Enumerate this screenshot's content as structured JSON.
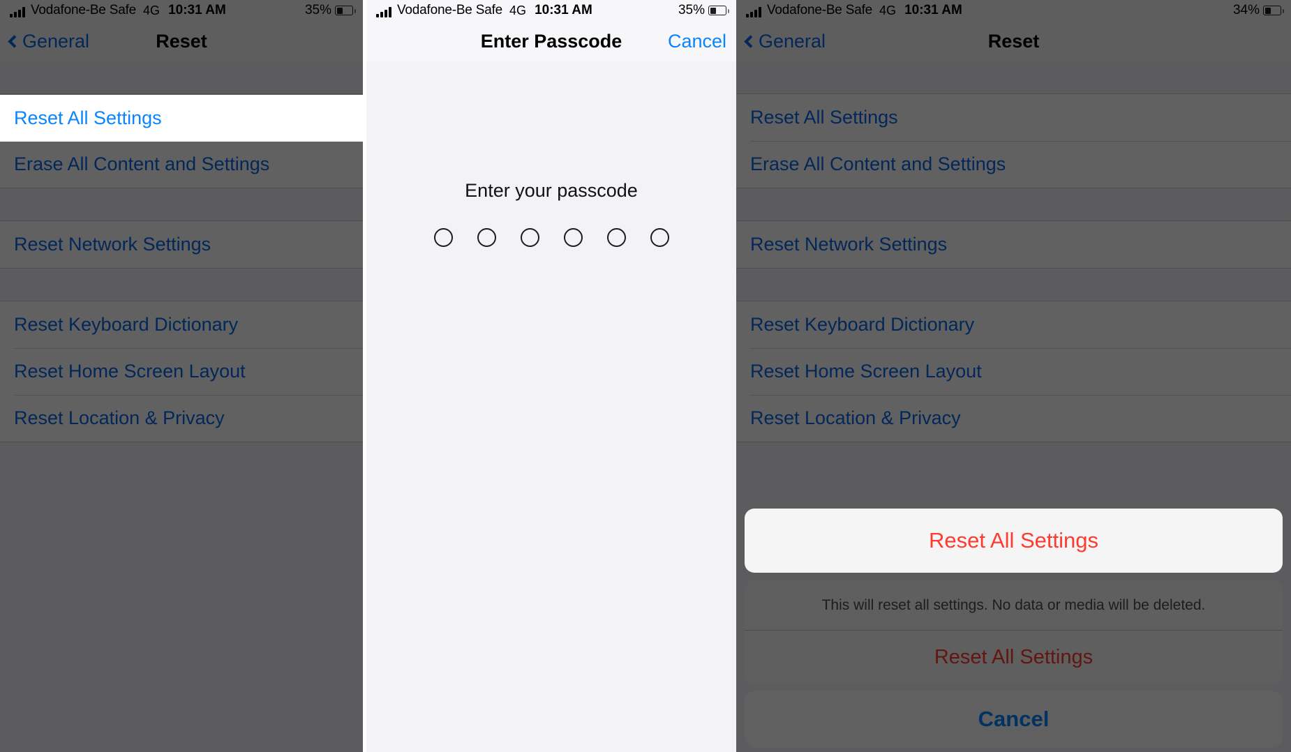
{
  "status_bar": {
    "carrier": "Vodafone-Be Safe",
    "network": "4G",
    "time": "10:31 AM",
    "battery_35": "35%",
    "battery_34": "34%"
  },
  "panel1": {
    "nav": {
      "back_label": "General",
      "title": "Reset"
    },
    "highlighted_row": "Reset All Settings",
    "rows": [
      "Reset All Settings",
      "Erase All Content and Settings",
      "Reset Network Settings",
      "Reset Keyboard Dictionary",
      "Reset Home Screen Layout",
      "Reset Location & Privacy"
    ]
  },
  "panel2": {
    "nav": {
      "title": "Enter Passcode",
      "cancel_label": "Cancel"
    },
    "prompt": "Enter your passcode",
    "dot_count": 6,
    "dots_filled": 0
  },
  "panel3": {
    "nav": {
      "back_label": "General",
      "title": "Reset"
    },
    "rows": [
      "Reset All Settings",
      "Erase All Content and Settings",
      "Reset Network Settings",
      "Reset Keyboard Dictionary",
      "Reset Home Screen Layout",
      "Reset Location & Privacy"
    ],
    "action_sheet": {
      "message": "This will reset all settings. No data or media will be deleted.",
      "destructive_label": "Reset All Settings",
      "cancel_label": "Cancel",
      "highlighted_label": "Reset All Settings"
    }
  },
  "colors": {
    "tint_blue": "#0a84ff",
    "destructive_red": "#ff3b30",
    "list_bg": "#ffffff",
    "page_bg": "#f2f2f7",
    "dim": "rgba(0,0,0,0.62)"
  }
}
